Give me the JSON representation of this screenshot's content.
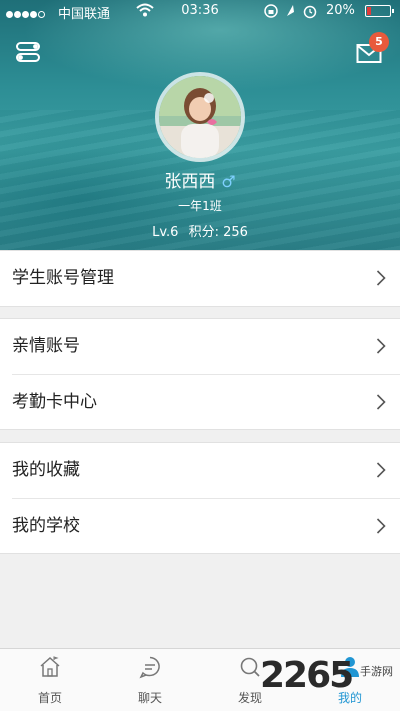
{
  "status_bar": {
    "carrier": "中国联通",
    "time": "03:36",
    "battery": "20%",
    "battery_level": 0.2,
    "signal_bars_filled": 4,
    "signal_bars_total": 5
  },
  "header": {
    "mail_badge": "5",
    "name": "张西西",
    "gender_symbol": "♂",
    "class_name": "一年1班",
    "level": "Lv.6",
    "points": "积分: 256"
  },
  "menu": {
    "group1": [
      {
        "label": "学生账号管理"
      }
    ],
    "group2": [
      {
        "label": "亲情账号"
      },
      {
        "label": "考勤卡中心"
      }
    ],
    "group3": [
      {
        "label": "我的收藏"
      },
      {
        "label": "我的学校"
      }
    ]
  },
  "tabs": [
    {
      "label": "首页",
      "icon": "home-icon"
    },
    {
      "label": "聊天",
      "icon": "chat-icon"
    },
    {
      "label": "发现",
      "icon": "discover-icon"
    },
    {
      "label": "我的",
      "icon": "profile-icon",
      "active": true
    }
  ],
  "watermark": {
    "big": "2265",
    "small": "手游网"
  },
  "colors": {
    "accent": "#2196d3",
    "badge": "#e85a3c",
    "header": "#2d8e95"
  }
}
